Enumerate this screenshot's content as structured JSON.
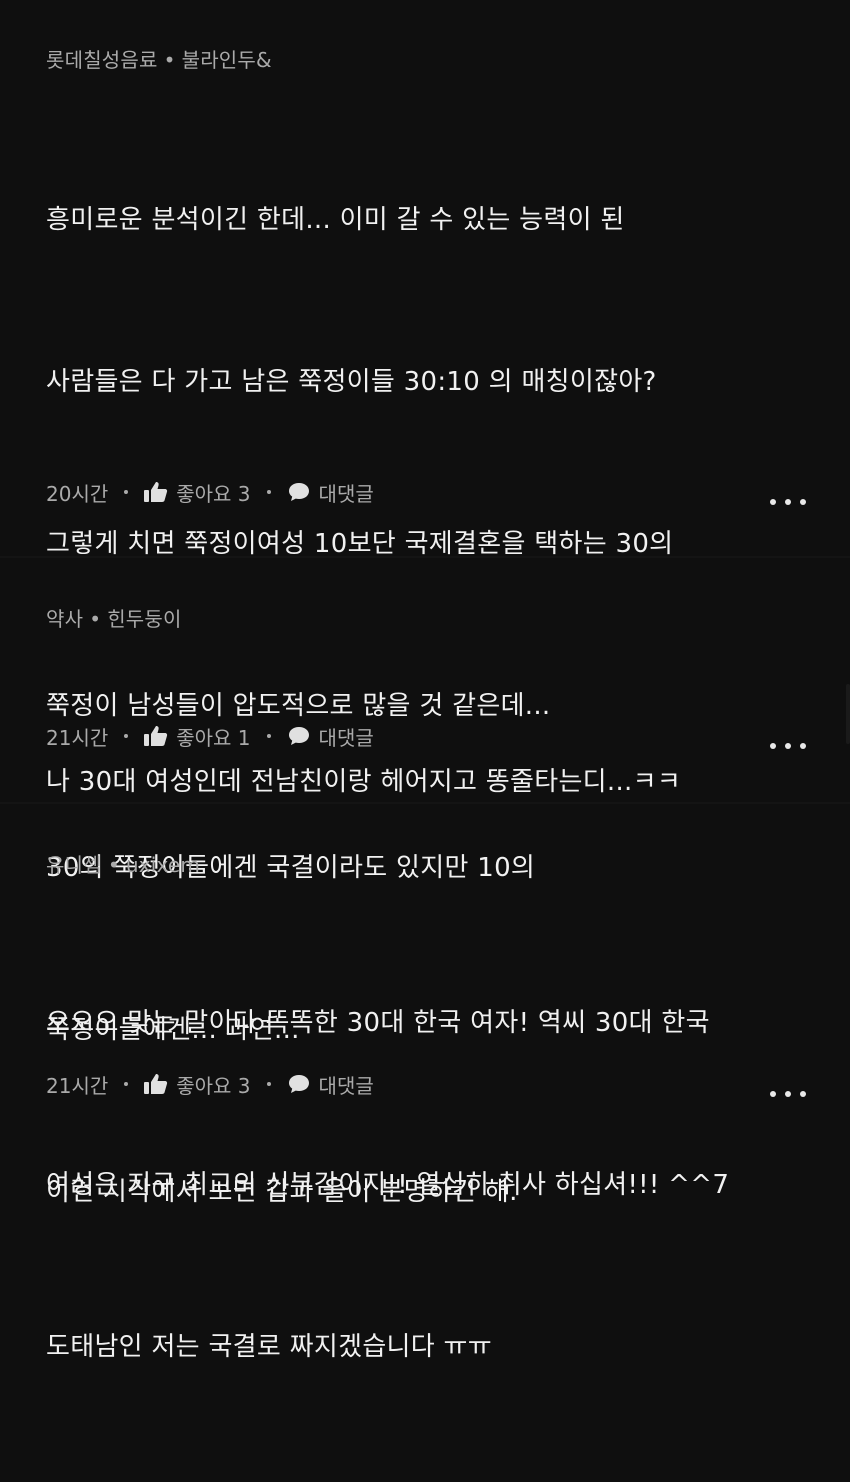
{
  "comments": [
    {
      "author_primary": "롯데칠성음료",
      "author_secondary": "불라인두&",
      "lines": [
        "흥미로운 분석이긴 한데... 이미 갈 수 있는 능력이 된",
        "사람들은 다 가고 남은 쭉정이들 30:10 의 매칭이잖아?",
        "그렇게 치면 쭉정이여성 10보단 국제결혼을 택하는 30의",
        "쭉정이 남성들이 압도적으로 많을 것 같은데...",
        "30의 쭉정이들에겐 국결이라도 있지만 10의",
        "쭉정이들에겐... 과연...",
        "이런 시각에서 보면 갑과 을이 분명하긴 해."
      ],
      "time": "20시간",
      "like_label": "좋아요 3",
      "reply_label": "대댓글"
    },
    {
      "author_primary": "약사",
      "author_secondary": "힌두둥이",
      "lines": [
        "나 30대 여성인데 전남친이랑 헤어지고 똥줄타는디...ㅋㅋ"
      ],
      "time": "21시간",
      "like_label": "좋아요 1",
      "reply_label": "대댓글"
    },
    {
      "author_primary": "유니셈",
      "author_secondary": "uxixem",
      "lines": [
        "오오오 맞는 말이다 똑똑한 30대 한국 여자! 역씨 30대 한국",
        "여성은 지구 최고의 신부감이지!! 열심히 취사 하십셔!!! ^^7",
        "도태남인 저는 국결로 짜지겠습니다 ㅠㅠ"
      ],
      "time": "21시간",
      "like_label": "좋아요 3",
      "reply_label": "대댓글"
    }
  ],
  "separator": "•",
  "colors": {
    "background": "#0f0f0f",
    "text_primary": "#f1f1f1",
    "text_secondary": "#aaaaaa"
  },
  "icons": {
    "like": "thumbs-up-icon",
    "reply": "speech-bubble-icon",
    "more": "more-options-icon"
  }
}
